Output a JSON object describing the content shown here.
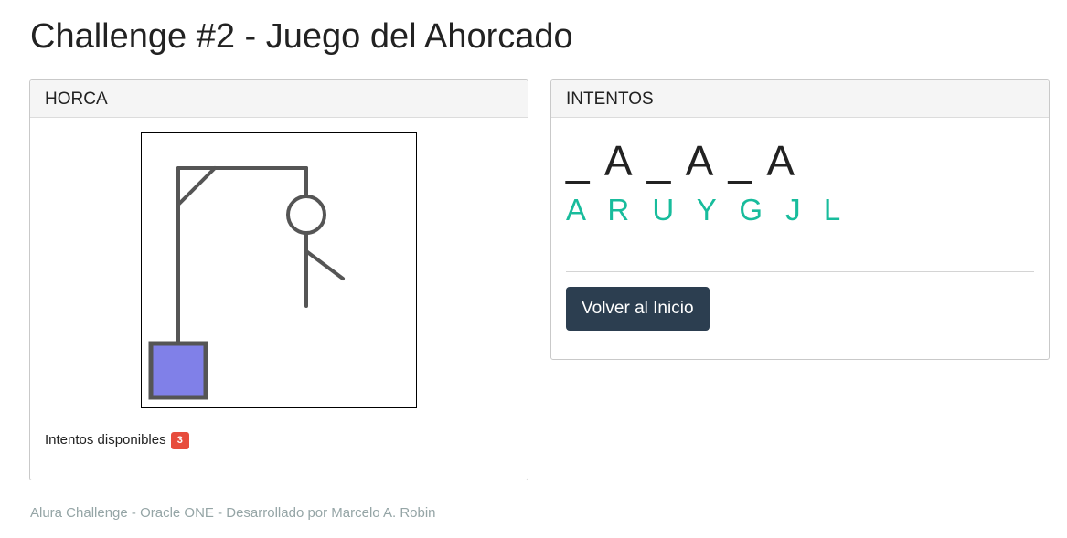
{
  "page": {
    "title": "Challenge #2 - Juego del Ahorcado"
  },
  "horca_panel": {
    "heading": "HORCA",
    "remaining_label": "Intentos disponibles",
    "remaining_count": "3",
    "colors": {
      "stroke": "#555555",
      "box_fill": "#8080e8",
      "badge": "#e74c3c"
    }
  },
  "intentos_panel": {
    "heading": "INTENTOS",
    "word": "_ A _ A _ A",
    "wrong_letters": "A R U Y G J L",
    "button_label": "Volver al Inicio",
    "colors": {
      "wrong_letters": "#18bc9c",
      "button": "#2c3e50"
    }
  },
  "footer": {
    "text": "Alura Challenge - Oracle ONE - Desarrollado por Marcelo A. Robin"
  }
}
